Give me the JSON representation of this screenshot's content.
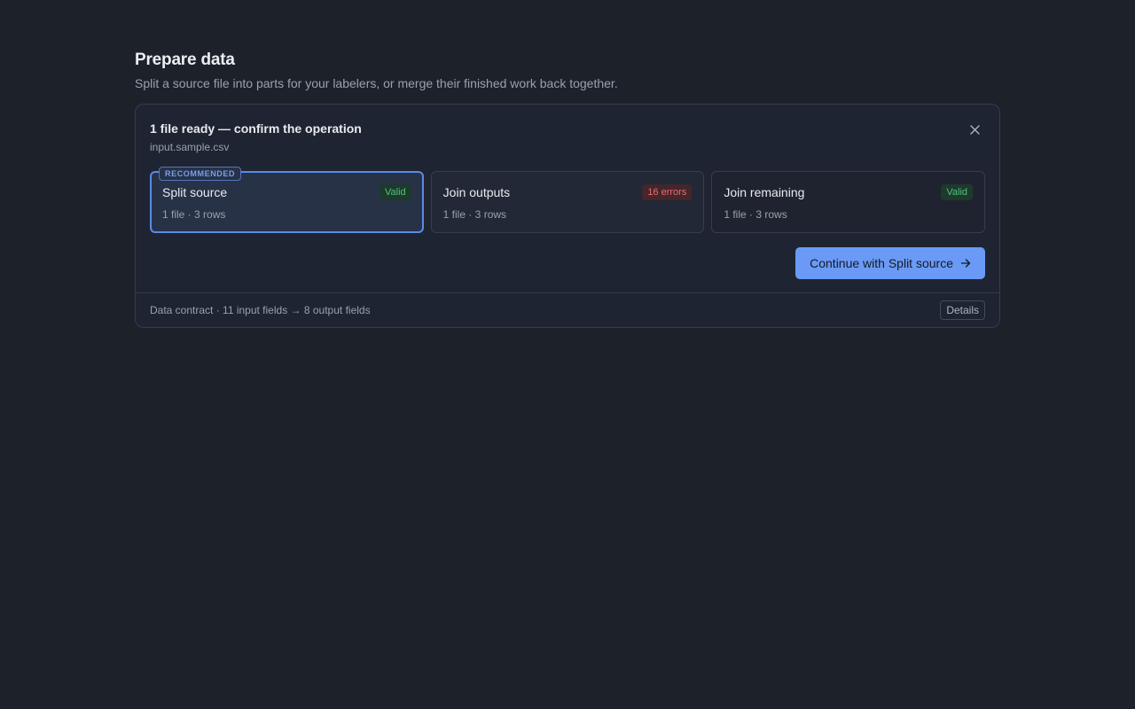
{
  "header": {
    "title": "Prepare data",
    "subtitle": "Split a source file into parts for your labelers, or merge their finished work back together."
  },
  "panel": {
    "title": "1 file ready — confirm the operation",
    "filename": "input.sample.csv",
    "close_icon": "close-icon",
    "recommended_label": "RECOMMENDED",
    "options": [
      {
        "title": "Split source",
        "badge": "Valid",
        "badge_status": "valid",
        "meta": "1 file · 3 rows",
        "selected": true
      },
      {
        "title": "Join outputs",
        "badge": "16 errors",
        "badge_status": "error",
        "meta": "1 file · 3 rows",
        "selected": false
      },
      {
        "title": "Join remaining",
        "badge": "Valid",
        "badge_status": "valid",
        "meta": "1 file · 3 rows",
        "selected": false
      }
    ],
    "continue_label": "Continue with Split source",
    "continue_icon": "arrow-right-icon"
  },
  "footer": {
    "contract_text": "Data contract · 11 input fields → 8 output fields",
    "details_label": "Details"
  },
  "colors": {
    "background": "#1d2129",
    "accent": "#6a9af5",
    "valid": "#52c07f",
    "error": "#f06a6a"
  }
}
